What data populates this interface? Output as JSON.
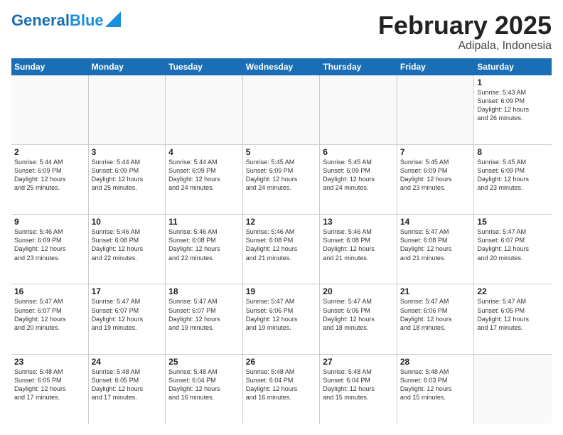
{
  "header": {
    "logo_general": "General",
    "logo_blue": "Blue",
    "month_title": "February 2025",
    "location": "Adipala, Indonesia"
  },
  "weekdays": [
    "Sunday",
    "Monday",
    "Tuesday",
    "Wednesday",
    "Thursday",
    "Friday",
    "Saturday"
  ],
  "weeks": [
    [
      {
        "day": "",
        "empty": true
      },
      {
        "day": "",
        "empty": true
      },
      {
        "day": "",
        "empty": true
      },
      {
        "day": "",
        "empty": true
      },
      {
        "day": "",
        "empty": true
      },
      {
        "day": "",
        "empty": true
      },
      {
        "day": "1",
        "lines": [
          "Sunrise: 5:43 AM",
          "Sunset: 6:09 PM",
          "Daylight: 12 hours",
          "and 26 minutes."
        ]
      }
    ],
    [
      {
        "day": "2",
        "lines": [
          "Sunrise: 5:44 AM",
          "Sunset: 6:09 PM",
          "Daylight: 12 hours",
          "and 25 minutes."
        ]
      },
      {
        "day": "3",
        "lines": [
          "Sunrise: 5:44 AM",
          "Sunset: 6:09 PM",
          "Daylight: 12 hours",
          "and 25 minutes."
        ]
      },
      {
        "day": "4",
        "lines": [
          "Sunrise: 5:44 AM",
          "Sunset: 6:09 PM",
          "Daylight: 12 hours",
          "and 24 minutes."
        ]
      },
      {
        "day": "5",
        "lines": [
          "Sunrise: 5:45 AM",
          "Sunset: 6:09 PM",
          "Daylight: 12 hours",
          "and 24 minutes."
        ]
      },
      {
        "day": "6",
        "lines": [
          "Sunrise: 5:45 AM",
          "Sunset: 6:09 PM",
          "Daylight: 12 hours",
          "and 24 minutes."
        ]
      },
      {
        "day": "7",
        "lines": [
          "Sunrise: 5:45 AM",
          "Sunset: 6:09 PM",
          "Daylight: 12 hours",
          "and 23 minutes."
        ]
      },
      {
        "day": "8",
        "lines": [
          "Sunrise: 5:45 AM",
          "Sunset: 6:09 PM",
          "Daylight: 12 hours",
          "and 23 minutes."
        ]
      }
    ],
    [
      {
        "day": "9",
        "lines": [
          "Sunrise: 5:46 AM",
          "Sunset: 6:09 PM",
          "Daylight: 12 hours",
          "and 23 minutes."
        ]
      },
      {
        "day": "10",
        "lines": [
          "Sunrise: 5:46 AM",
          "Sunset: 6:08 PM",
          "Daylight: 12 hours",
          "and 22 minutes."
        ]
      },
      {
        "day": "11",
        "lines": [
          "Sunrise: 5:46 AM",
          "Sunset: 6:08 PM",
          "Daylight: 12 hours",
          "and 22 minutes."
        ]
      },
      {
        "day": "12",
        "lines": [
          "Sunrise: 5:46 AM",
          "Sunset: 6:08 PM",
          "Daylight: 12 hours",
          "and 21 minutes."
        ]
      },
      {
        "day": "13",
        "lines": [
          "Sunrise: 5:46 AM",
          "Sunset: 6:08 PM",
          "Daylight: 12 hours",
          "and 21 minutes."
        ]
      },
      {
        "day": "14",
        "lines": [
          "Sunrise: 5:47 AM",
          "Sunset: 6:08 PM",
          "Daylight: 12 hours",
          "and 21 minutes."
        ]
      },
      {
        "day": "15",
        "lines": [
          "Sunrise: 5:47 AM",
          "Sunset: 6:07 PM",
          "Daylight: 12 hours",
          "and 20 minutes."
        ]
      }
    ],
    [
      {
        "day": "16",
        "lines": [
          "Sunrise: 5:47 AM",
          "Sunset: 6:07 PM",
          "Daylight: 12 hours",
          "and 20 minutes."
        ]
      },
      {
        "day": "17",
        "lines": [
          "Sunrise: 5:47 AM",
          "Sunset: 6:07 PM",
          "Daylight: 12 hours",
          "and 19 minutes."
        ]
      },
      {
        "day": "18",
        "lines": [
          "Sunrise: 5:47 AM",
          "Sunset: 6:07 PM",
          "Daylight: 12 hours",
          "and 19 minutes."
        ]
      },
      {
        "day": "19",
        "lines": [
          "Sunrise: 5:47 AM",
          "Sunset: 6:06 PM",
          "Daylight: 12 hours",
          "and 19 minutes."
        ]
      },
      {
        "day": "20",
        "lines": [
          "Sunrise: 5:47 AM",
          "Sunset: 6:06 PM",
          "Daylight: 12 hours",
          "and 18 minutes."
        ]
      },
      {
        "day": "21",
        "lines": [
          "Sunrise: 5:47 AM",
          "Sunset: 6:06 PM",
          "Daylight: 12 hours",
          "and 18 minutes."
        ]
      },
      {
        "day": "22",
        "lines": [
          "Sunrise: 5:47 AM",
          "Sunset: 6:05 PM",
          "Daylight: 12 hours",
          "and 17 minutes."
        ]
      }
    ],
    [
      {
        "day": "23",
        "lines": [
          "Sunrise: 5:48 AM",
          "Sunset: 6:05 PM",
          "Daylight: 12 hours",
          "and 17 minutes."
        ]
      },
      {
        "day": "24",
        "lines": [
          "Sunrise: 5:48 AM",
          "Sunset: 6:05 PM",
          "Daylight: 12 hours",
          "and 17 minutes."
        ]
      },
      {
        "day": "25",
        "lines": [
          "Sunrise: 5:48 AM",
          "Sunset: 6:04 PM",
          "Daylight: 12 hours",
          "and 16 minutes."
        ]
      },
      {
        "day": "26",
        "lines": [
          "Sunrise: 5:48 AM",
          "Sunset: 6:04 PM",
          "Daylight: 12 hours",
          "and 16 minutes."
        ]
      },
      {
        "day": "27",
        "lines": [
          "Sunrise: 5:48 AM",
          "Sunset: 6:04 PM",
          "Daylight: 12 hours",
          "and 15 minutes."
        ]
      },
      {
        "day": "28",
        "lines": [
          "Sunrise: 5:48 AM",
          "Sunset: 6:03 PM",
          "Daylight: 12 hours",
          "and 15 minutes."
        ]
      },
      {
        "day": "",
        "empty": true
      }
    ]
  ]
}
